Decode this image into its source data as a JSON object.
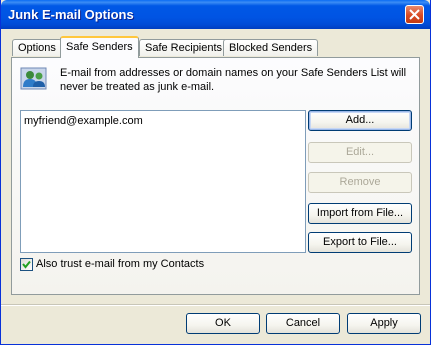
{
  "window": {
    "title": "Junk E-mail Options"
  },
  "tabs": [
    {
      "label": "Options"
    },
    {
      "label": "Safe Senders"
    },
    {
      "label": "Safe Recipients"
    },
    {
      "label": "Blocked Senders"
    }
  ],
  "active_tab": "Safe Senders",
  "panel": {
    "info_text": "E-mail from addresses or domain names on your Safe Senders List will never be treated as junk e-mail.",
    "info_icon": "users-icon",
    "list_items": [
      "myfriend@example.com"
    ],
    "side_buttons": {
      "add": "Add...",
      "edit": "Edit...",
      "remove": "Remove",
      "import": "Import from File...",
      "export": "Export to File..."
    },
    "checkbox": {
      "label": "Also trust e-mail from my Contacts",
      "checked": true
    }
  },
  "footer": {
    "ok": "OK",
    "cancel": "Cancel",
    "apply": "Apply"
  },
  "colors": {
    "titlebar": "#0054e3",
    "dialog_bg": "#ece9d8",
    "tab_highlight": "#ffc73c",
    "close_button": "#d94a23"
  }
}
